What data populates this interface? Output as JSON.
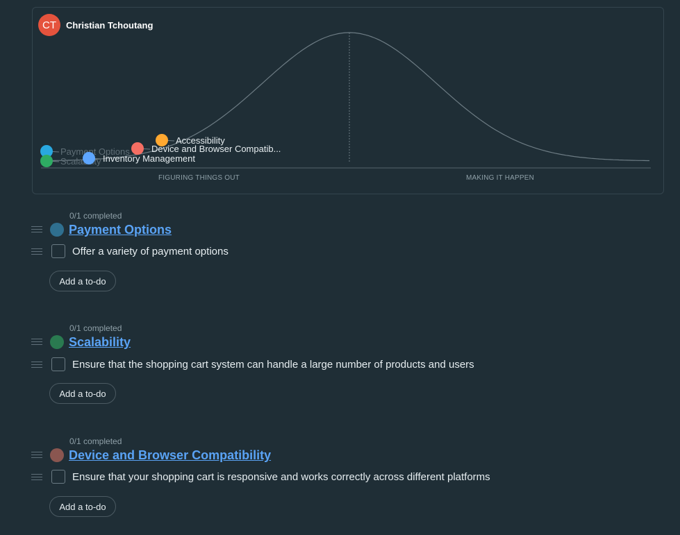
{
  "hill_chart": {
    "owner_initials": "CT",
    "owner_name": "Christian Tchoutang",
    "phase_left": "FIGURING THINGS OUT",
    "phase_right": "MAKING IT HAPPEN",
    "dots": [
      {
        "label": "Payment Options",
        "color": "#29a8e0",
        "faded": true
      },
      {
        "label": "Scalability",
        "color": "#2eab63",
        "faded": true
      },
      {
        "label": "Inventory Management",
        "color": "#5ea6ff",
        "faded": false
      },
      {
        "label": "Device and Browser Compatib...",
        "color": "#f46e63",
        "faded": false
      },
      {
        "label": "Accessibility",
        "color": "#ffa830",
        "faded": false
      }
    ]
  },
  "scopes": [
    {
      "progress": "0/1 completed",
      "title": "Payment Options",
      "color": "#2f6f8f",
      "todo": "Offer a variety of payment options",
      "add_label": "Add a to-do"
    },
    {
      "progress": "0/1 completed",
      "title": "Scalability",
      "color": "#2a7a50",
      "todo": "Ensure that the shopping cart system can handle a large number of products and users",
      "add_label": "Add a to-do"
    },
    {
      "progress": "0/1 completed",
      "title": "Device and Browser Compatibility",
      "color": "#8a5650",
      "todo": "Ensure that your shopping cart is responsive and works correctly across different platforms",
      "add_label": "Add a to-do"
    }
  ]
}
